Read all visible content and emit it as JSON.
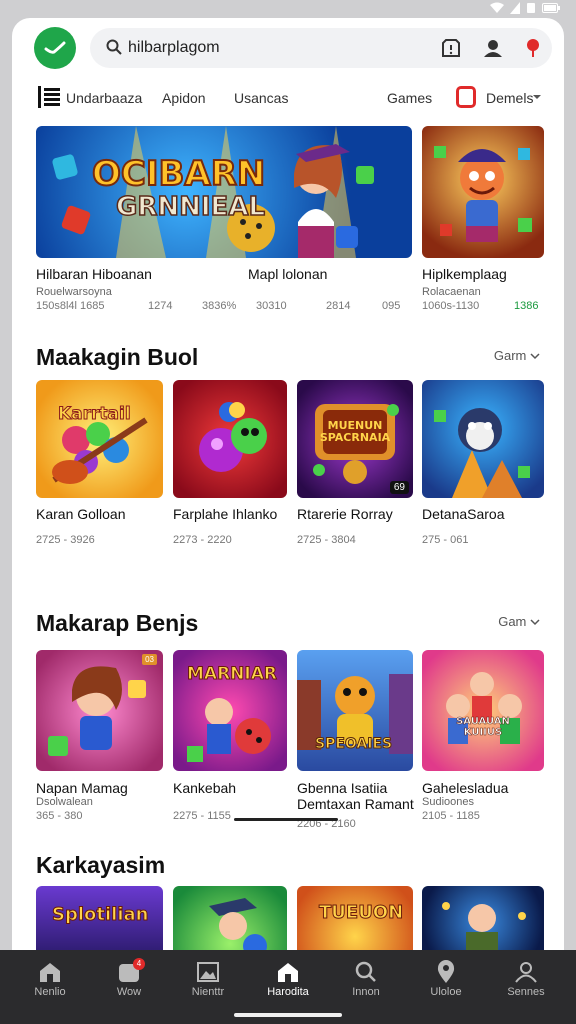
{
  "status_bar": {
    "icons": [
      "wifi-icon",
      "signal-icon",
      "sim-icon",
      "battery-icon"
    ]
  },
  "search": {
    "value": "hilbarplagom"
  },
  "tabs": [
    {
      "label": "Undarbaaza"
    },
    {
      "label": "Apidon"
    },
    {
      "label": "Usancas"
    },
    {
      "label": "Games"
    },
    {
      "label": "Demels"
    }
  ],
  "featured": [
    {
      "banner_line1": "OCIBARN",
      "banner_line2": "GRNNIEAL",
      "badge": "",
      "title": "Hilbaran Hiboanan",
      "subtitle": "Rouelwarsoyna",
      "stats": [
        "150s8l4l 1685",
        "1274",
        "3836%"
      ]
    },
    {
      "banner_line1": "",
      "banner_line2": "",
      "badge": "",
      "title": "Mapl lolonan",
      "subtitle": "",
      "stats": [
        "30310",
        "2814",
        "095"
      ]
    },
    {
      "banner_line1": "",
      "banner_line2": "",
      "badge": "",
      "title": "Hiplkemplaag",
      "subtitle": "Rolacaenan",
      "stats": [
        "1060s-1130",
        "1386"
      ]
    }
  ],
  "sections": [
    {
      "title": "Maakagin Buol",
      "more": "Garm",
      "cards": [
        {
          "art": "Karrtail",
          "title": "Karan Golloan",
          "meta": "2725 - 3926"
        },
        {
          "art": "",
          "title": "Farplahe Ihlanko",
          "meta": "2273 - 2220"
        },
        {
          "art": "MUENUN SPACRNAIA",
          "badge": "69",
          "title": "Rtarerie Rorray",
          "meta": "2725 - 3804"
        },
        {
          "art": "",
          "title": "DetanaSaroa",
          "meta": "275 - 061"
        }
      ]
    },
    {
      "title": "Makarap Benjs",
      "more": "Gam",
      "cards": [
        {
          "art": "",
          "badge": "03",
          "title": "Napan Mamag",
          "subtitle": "Dsolwalean",
          "meta": "365 - 380"
        },
        {
          "art": "MARNIAR",
          "title": "Kankebah",
          "meta": "2275 - 1155"
        },
        {
          "art": "SPEOAIES",
          "title": "Gbenna Isatiia",
          "title2": "Demtaxan Ramant",
          "meta": "2206 - 2160"
        },
        {
          "art": "SAUAUAN KUIIUS",
          "title": "Gahelesladua",
          "subtitle": "Sudioones",
          "meta": "2105 - 1185"
        }
      ]
    },
    {
      "title": "Karkayasim",
      "more": "",
      "cards": [
        {
          "art": "Splotilian"
        },
        {
          "art": ""
        },
        {
          "art": "TUEUON"
        },
        {
          "art": ""
        }
      ]
    }
  ],
  "bottom_nav": [
    {
      "label": "Nenlio",
      "icon": "home-icon"
    },
    {
      "label": "Wow",
      "icon": "notification-icon",
      "badge": "4"
    },
    {
      "label": "Nienttr",
      "icon": "image-icon"
    },
    {
      "label": "Harodita",
      "icon": "home-icon"
    },
    {
      "label": "Innon",
      "icon": "search-icon"
    },
    {
      "label": "Uloloe",
      "icon": "location-icon"
    },
    {
      "label": "Sennes",
      "icon": "profile-icon"
    }
  ],
  "colors": {
    "accent_green": "#1fa64a",
    "highlight_green": "#1b9a3e",
    "alert_red": "#e02a2a",
    "nav_bg": "#2b2b2d"
  }
}
